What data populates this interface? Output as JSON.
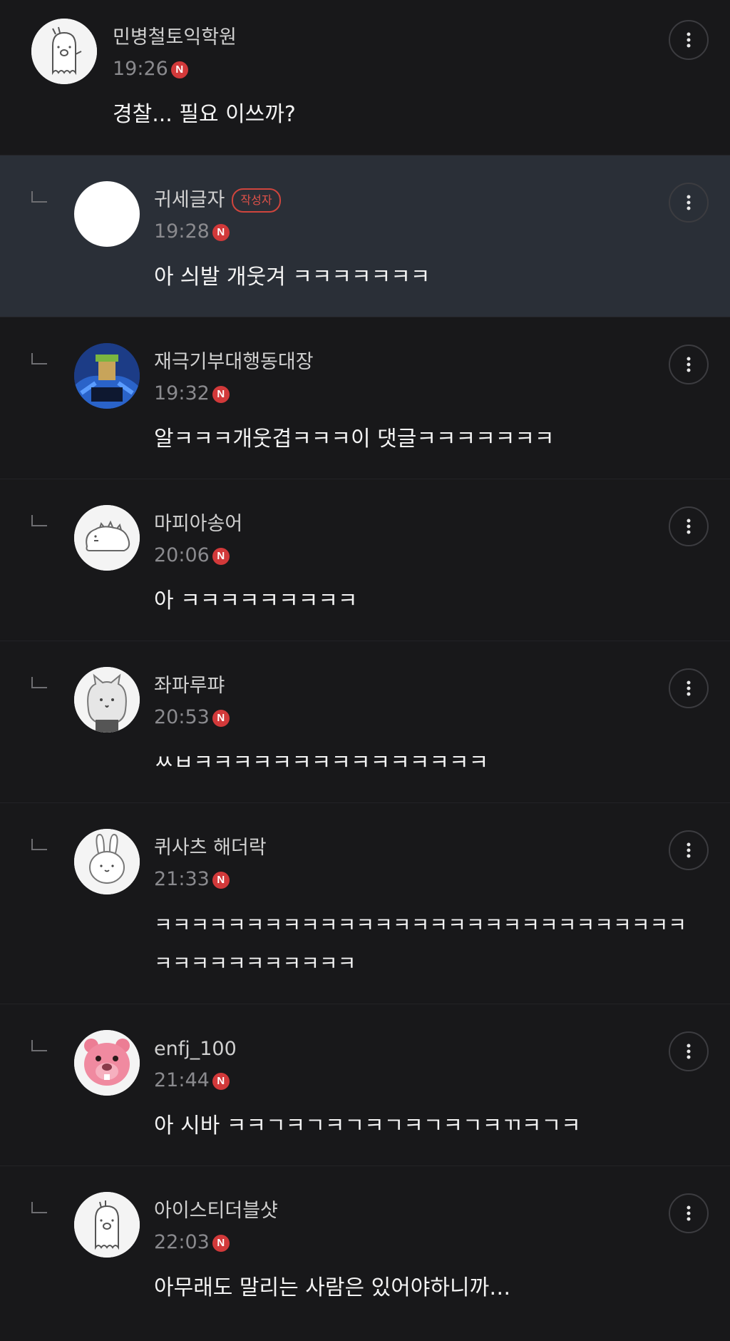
{
  "comments": [
    {
      "author": "민병철토익학원",
      "time": "19:26",
      "new": "N",
      "text": "경찰... 필요 이쓰까?",
      "more_icon": "more-vertical-icon"
    },
    {
      "author": "귀세글자",
      "badge": "작성자",
      "time": "19:28",
      "new": "N",
      "text": "아 싀발 개웃겨 ㅋㅋㅋㅋㅋㅋㅋ",
      "highlight_color": "#2a2f37"
    },
    {
      "author": "재극기부대행동대장",
      "time": "19:32",
      "new": "N",
      "text": "알ㅋㅋㅋ개웃겹ㅋㅋㅋ이 댓글ㅋㅋㅋㅋㅋㅋㅋ"
    },
    {
      "author": "마피아송어",
      "time": "20:06",
      "new": "N",
      "text": "아 ㅋㅋㅋㅋㅋㅋㅋㅋㅋ"
    },
    {
      "author": "좌파루퍄",
      "time": "20:53",
      "new": "N",
      "text": "ㅆㅂㅋㅋㅋㅋㅋㅋㅋㅋㅋㅋㅋㅋㅋㅋㅋ"
    },
    {
      "author": "퀴사츠 해더락",
      "time": "21:33",
      "new": "N",
      "text": "ㅋㅋㅋㅋㅋㅋㅋㅋㅋㅋㅋㅋㅋㅋㅋㅋㅋㅋㅋㅋㅋㅋㅋㅋㅋㅋㅋㅋㅋㅋㅋㅋㅋㅋㅋㅋㅋㅋㅋㅋ"
    },
    {
      "author": "enfj_100",
      "time": "21:44",
      "new": "N",
      "text": "아 시바 ㅋㅋㄱㅋㄱㅋㄱㅋㄱㅋㄱㅋㄱㅋㄲㅋㄱㅋ"
    },
    {
      "author": "아이스티더블샷",
      "time": "22:03",
      "new": "N",
      "text": "아무래도 말리는 사람은 있어야하니까…"
    }
  ],
  "colors": {
    "background": "#18181a",
    "highlight": "#2a2f37",
    "new_badge": "#d2393a",
    "writer_badge": "#d0453d"
  }
}
